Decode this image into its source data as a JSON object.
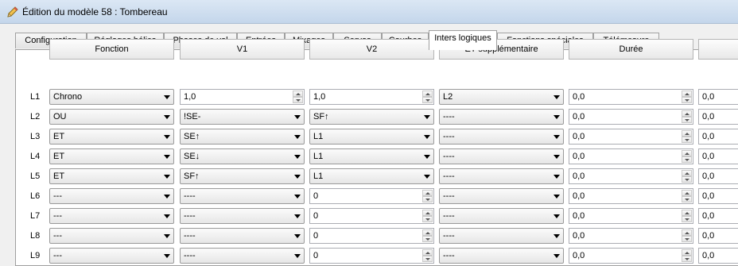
{
  "window": {
    "title": "Édition du modèle 58 : Tombereau"
  },
  "tabs": [
    "Configuration",
    "Réglages hélico",
    "Phases de vol",
    "Entrées",
    "Mixages",
    "Servos",
    "Courbes",
    "Inters logiques",
    "Fonctions spéciales",
    "Télémesure"
  ],
  "active_tab": "Inters logiques",
  "columns": [
    "Fonction",
    "V1",
    "V2",
    "ET supplémentaire",
    "Durée",
    ""
  ],
  "rows": [
    {
      "label": "L1",
      "fonction": "Chrono",
      "v1": "1,0",
      "v2": "1,0",
      "et": "L2",
      "duree": "0,0",
      "extra": "0,0"
    },
    {
      "label": "L2",
      "fonction": "OU",
      "v1": "!SE-",
      "v2": "SF↑",
      "et": "----",
      "duree": "0,0",
      "extra": "0,0"
    },
    {
      "label": "L3",
      "fonction": "ET",
      "v1": "SE↑",
      "v2": "L1",
      "et": "----",
      "duree": "0,0",
      "extra": "0,0"
    },
    {
      "label": "L4",
      "fonction": "ET",
      "v1": "SE↓",
      "v2": "L1",
      "et": "----",
      "duree": "0,0",
      "extra": "0,0"
    },
    {
      "label": "L5",
      "fonction": "ET",
      "v1": "SF↑",
      "v2": "L1",
      "et": "----",
      "duree": "0,0",
      "extra": "0,0"
    },
    {
      "label": "L6",
      "fonction": "---",
      "v1": "----",
      "v2": "0",
      "et": "----",
      "duree": "0,0",
      "extra": "0,0"
    },
    {
      "label": "L7",
      "fonction": "---",
      "v1": "----",
      "v2": "0",
      "et": "----",
      "duree": "0,0",
      "extra": "0,0"
    },
    {
      "label": "L8",
      "fonction": "---",
      "v1": "----",
      "v2": "0",
      "et": "----",
      "duree": "0,0",
      "extra": "0,0"
    },
    {
      "label": "L9",
      "fonction": "---",
      "v1": "----",
      "v2": "0",
      "et": "----",
      "duree": "0,0",
      "extra": "0,0"
    }
  ],
  "cell_types": {
    "L1": {
      "v1": "spin",
      "v2": "spin"
    },
    "default": {
      "v1": "combo",
      "v2": "combo"
    },
    "L6": {
      "v1": "combo",
      "v2": "spin"
    },
    "L7": {
      "v1": "combo",
      "v2": "spin"
    },
    "L8": {
      "v1": "combo",
      "v2": "spin"
    },
    "L9": {
      "v1": "combo",
      "v2": "spin"
    }
  },
  "icons": {
    "window": "pencil-icon"
  }
}
